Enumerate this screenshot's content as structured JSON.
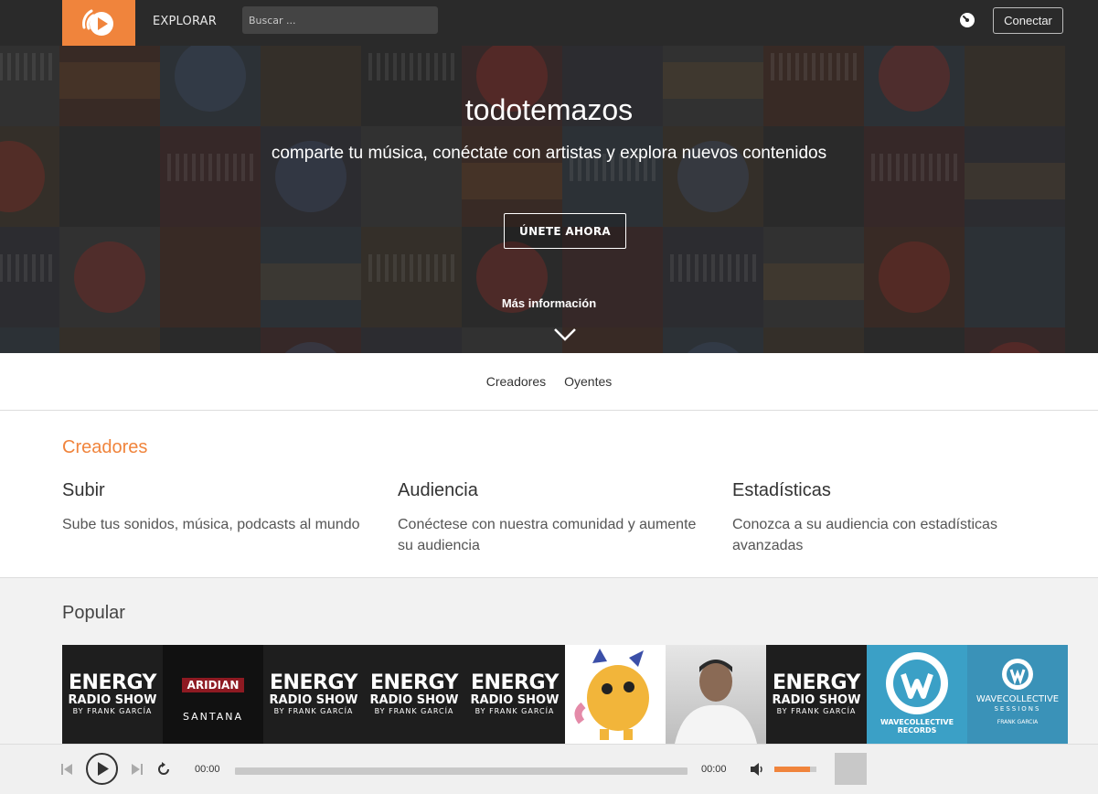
{
  "header": {
    "logo_icon": "play-circle-logo",
    "explore_label": "EXPLORAR",
    "search_placeholder": "Buscar ...",
    "connect_label": "Conectar",
    "accent_color": "#f0843c"
  },
  "hero": {
    "title": "todotemazos",
    "subtitle": "comparte tu música, conéctate con artistas y explora nuevos contenidos",
    "join_label": "ÚNETE AHORA",
    "more_label": "Más información"
  },
  "tabs": [
    "Creadores",
    "Oyentes"
  ],
  "creators": {
    "title": "Creadores",
    "features": [
      {
        "title": "Subir",
        "text": "Sube tus sonidos, música, podcasts al mundo"
      },
      {
        "title": "Audiencia",
        "text": "Conéctese con nuestra comunidad y aumente su audiencia"
      },
      {
        "title": "Estadísticas",
        "text": "Conozca a su audiencia con estadísticas avanzadas"
      }
    ]
  },
  "popular": {
    "title": "Popular",
    "covers": {
      "energy_line1": "ENERGY",
      "energy_line2": "RADIO SHOW",
      "energy_line3": "BY FRANK GARCÍA",
      "aridian_title": "ARIDIAN",
      "aridian_artist": "SANTANA",
      "wave_records": "WAVECOLLECTIVE RECORDS",
      "wave_sessions_1": "WAVECOLLECTIVE",
      "wave_sessions_2": "SESSIONS",
      "wave_sessions_3": "FRANK GARCIA"
    }
  },
  "player": {
    "current_time": "00:00",
    "total_time": "00:00",
    "volume_level": 0.85
  }
}
